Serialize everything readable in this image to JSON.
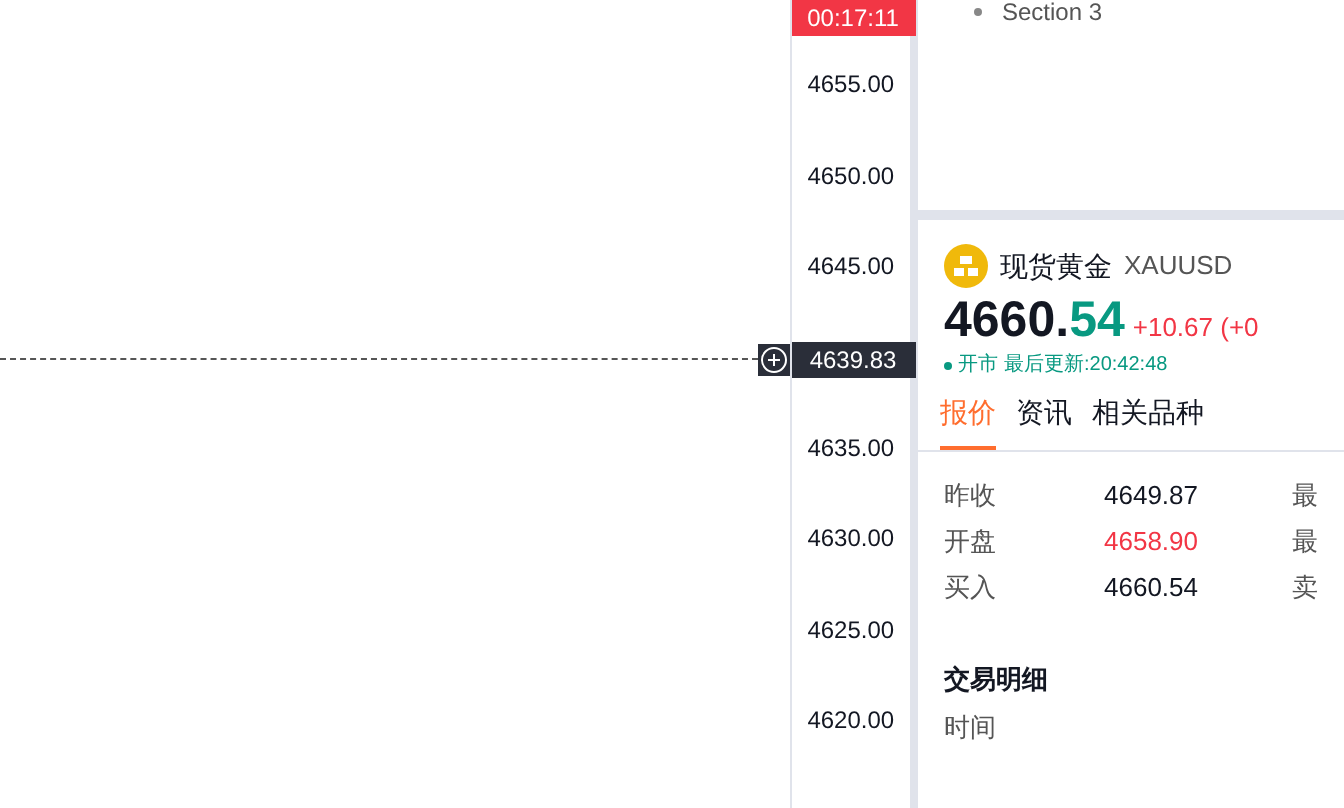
{
  "chart": {
    "countdown": "00:17:11",
    "axis_labels": [
      "4655.00",
      "4650.00",
      "4645.00",
      "4635.00",
      "4630.00",
      "4625.00",
      "4620.00"
    ],
    "current_price": "4639.83"
  },
  "outline": {
    "items": [
      {
        "label": "Section 3",
        "expanded": false
      }
    ]
  },
  "quote": {
    "name": "现货黄金",
    "symbol": "XAUUSD",
    "price_int": "4660.",
    "price_dec": "54",
    "change": "+10.67 (+0",
    "status": "开市",
    "updated": "最后更新:20:42:48",
    "tabs": [
      {
        "label": "报价",
        "selected": true
      },
      {
        "label": "资讯",
        "selected": false
      },
      {
        "label": "相关品种",
        "selected": false
      }
    ],
    "rows": [
      {
        "label": "昨收",
        "value": "4649.87",
        "up": false,
        "label_2": "最"
      },
      {
        "label": "开盘",
        "value": "4658.90",
        "up": true,
        "label_2": "最"
      },
      {
        "label": "买入",
        "value": "4660.54",
        "up": false,
        "label_2": "卖"
      }
    ],
    "trades_title": "交易明细",
    "trades_column": "时间"
  }
}
